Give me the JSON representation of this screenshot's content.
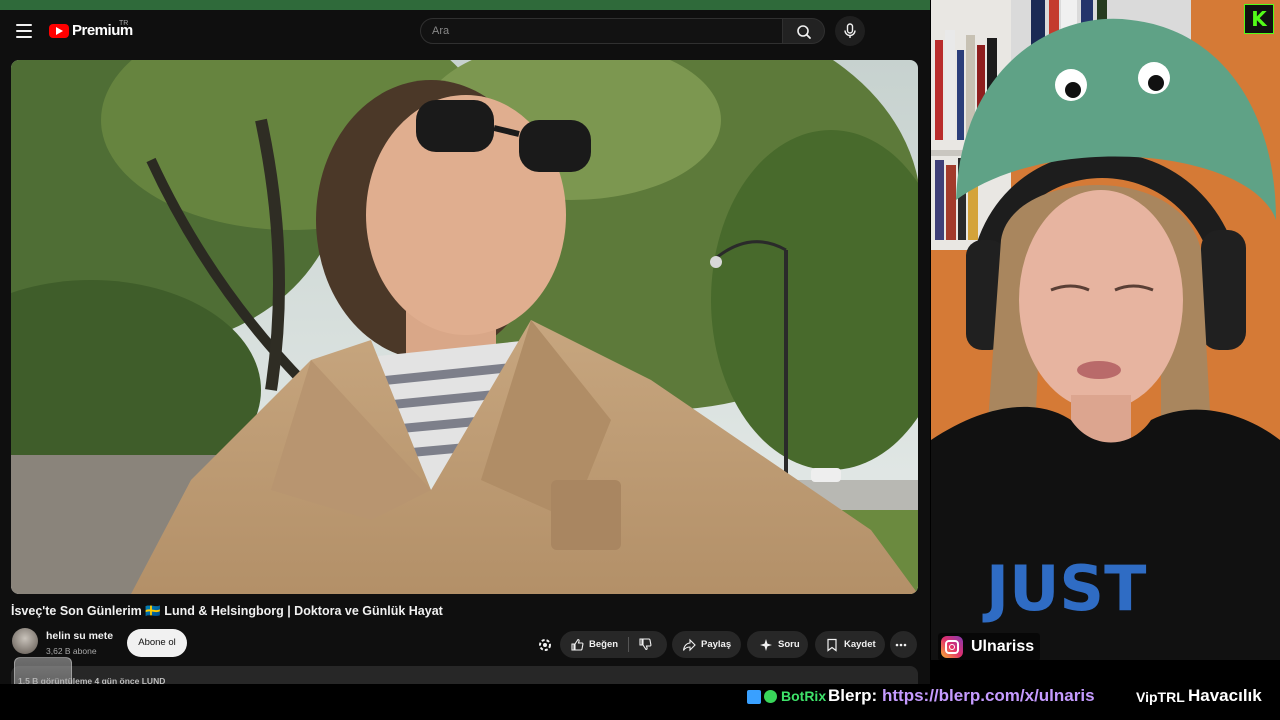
{
  "app": {
    "name": "YouTube",
    "logo_text": "Premium",
    "country_code": "TR"
  },
  "search": {
    "placeholder": "Ara"
  },
  "video": {
    "title": "İsveç'te Son Günlerim 🇸🇪 Lund & Helsingborg | Doktora ve Günlük Hayat",
    "channel": {
      "name": "helin su mete",
      "subscribers": "3,62 B abone"
    },
    "subscribe_label": "Abone ol",
    "actions": {
      "like": "Beğen",
      "share": "Paylaş",
      "ask": "Soru",
      "save": "Kaydet"
    },
    "meta": "1,5 B görüntüleme  4 gün önce  LUND"
  },
  "stream": {
    "instagram_handle": "Ulnariss",
    "kick_logo": "K",
    "ticker": {
      "bot_name": "BotRix",
      "blerp_label": "Blerp:",
      "blerp_url": "https://blerp.com/x/ulnaris",
      "vip_name": "VipTRL",
      "vip_message": "Havacılık"
    }
  },
  "colors": {
    "brand_red": "#ff0000",
    "kick_green": "#53fc18",
    "link_purple": "#c59bff",
    "botrix_green": "#3ee26a"
  }
}
